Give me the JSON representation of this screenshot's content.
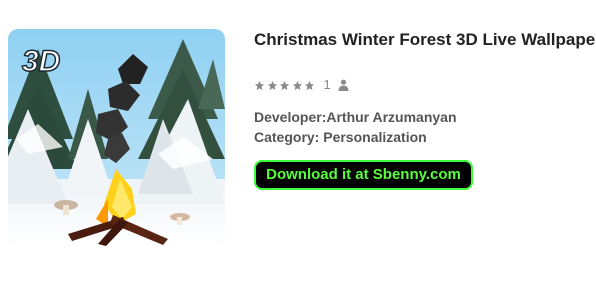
{
  "app": {
    "title": "Christmas Winter Forest 3D Live Wallpaper",
    "icon_badge": "3D",
    "rating_count": "1",
    "stars_total": 5,
    "developer_line": "Developer:Arthur Arzumanyan",
    "category_line": "Category: Personalization"
  },
  "download": {
    "label": "Download it at Sbenny.com"
  },
  "colors": {
    "button_bg": "#000000",
    "button_border": "#3bff3b",
    "button_text": "#58ff3a",
    "star_gray": "#8a8a8a"
  }
}
